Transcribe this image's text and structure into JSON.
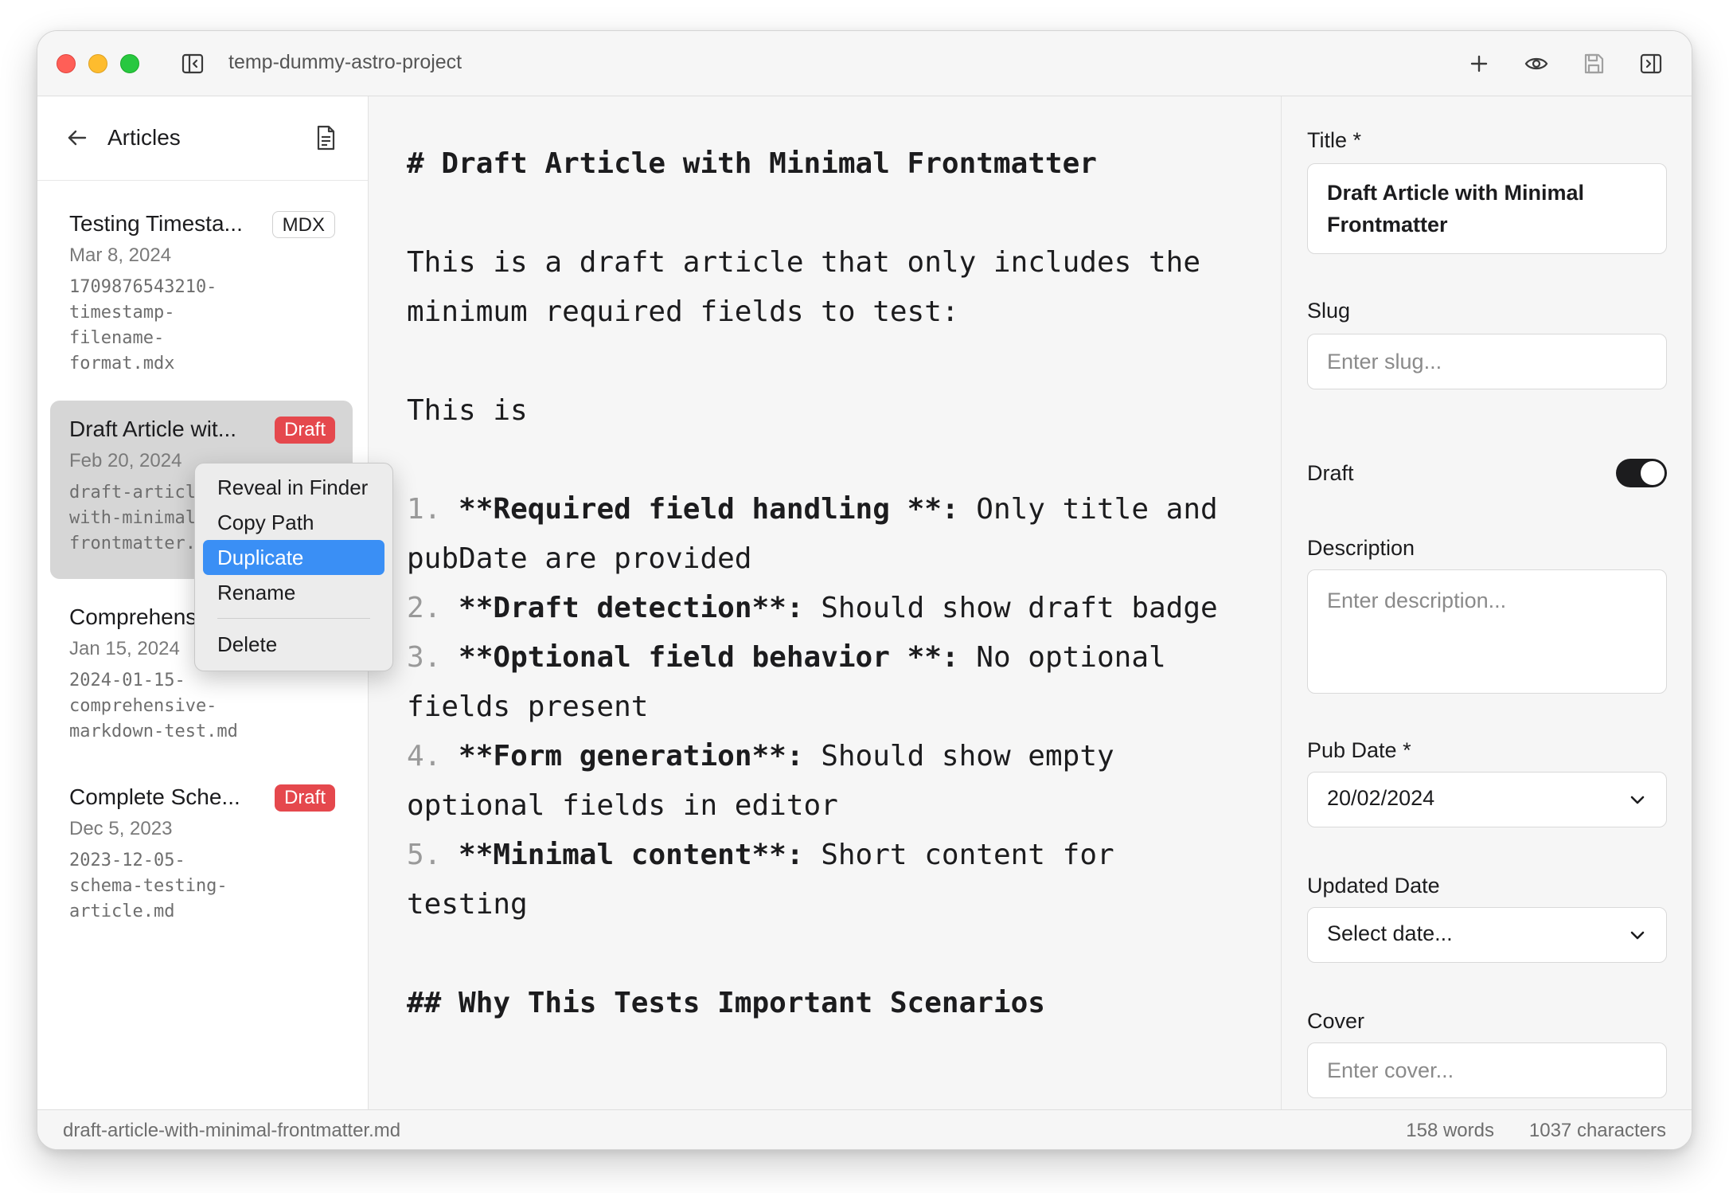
{
  "window": {
    "project_name": "temp-dummy-astro-project"
  },
  "toolbar": {
    "icons": [
      "sidebar-toggle-icon",
      "plus-icon",
      "eye-icon",
      "save-icon",
      "right-panel-toggle-icon"
    ]
  },
  "sidebar": {
    "title": "Articles",
    "articles": [
      {
        "title": "Testing Timesta...",
        "date": "Mar 8, 2024",
        "filename": "1709876543210-\ntimestamp-\nfilename-\nformat.mdx",
        "badge": "MDX",
        "selected": false
      },
      {
        "title": "Draft Article wit...",
        "date": "Feb 20, 2024",
        "filename": "draft-article-\nwith-minimal-\nfrontmatter.md",
        "badge": "Draft",
        "selected": true
      },
      {
        "title": "Comprehensive Ma...",
        "date": "Jan 15, 2024",
        "filename": "2024-01-15-\ncomprehensive-\nmarkdown-test.md",
        "badge": "",
        "selected": false
      },
      {
        "title": "Complete Sche...",
        "date": "Dec 5, 2023",
        "filename": "2023-12-05-\nschema-testing-\narticle.md",
        "badge": "Draft",
        "selected": false
      }
    ]
  },
  "context_menu": {
    "items": [
      "Reveal in Finder",
      "Copy Path",
      "Duplicate",
      "Rename",
      "Delete"
    ],
    "active_item": "Duplicate"
  },
  "editor": {
    "heading": "# Draft Article with Minimal Frontmatter",
    "para1_line1": "This is a draft article that only includes the",
    "para1_line2": "minimum required fields to test:",
    "para2": "This is",
    "list": [
      {
        "num": "1.",
        "bold": "**Required field handling **:",
        "rest": " Only title and",
        "cont": "pubDate are provided"
      },
      {
        "num": "2.",
        "bold": "**Draft detection**:",
        "rest": " Should show draft badge",
        "cont": ""
      },
      {
        "num": "3.",
        "bold": "**Optional field behavior **:",
        "rest": " No optional",
        "cont": "fields present"
      },
      {
        "num": "4.",
        "bold": "**Form generation**:",
        "rest": " Should show empty",
        "cont": "optional fields in editor"
      },
      {
        "num": "5.",
        "bold": "**Minimal content**:",
        "rest": " Short content for",
        "cont": "testing"
      }
    ],
    "subheading": "## Why This Tests Important Scenarios"
  },
  "panel": {
    "title_label": "Title *",
    "title_value": "Draft Article with Minimal Frontmatter",
    "slug_label": "Slug",
    "slug_placeholder": "Enter slug...",
    "draft_label": "Draft",
    "draft_on": true,
    "description_label": "Description",
    "description_placeholder": "Enter description...",
    "pubdate_label": "Pub Date *",
    "pubdate_value": "20/02/2024",
    "updated_label": "Updated Date",
    "updated_placeholder": "Select date...",
    "cover_label": "Cover",
    "cover_placeholder": "Enter cover..."
  },
  "status": {
    "filename": "draft-article-with-minimal-frontmatter.md",
    "words": "158 words",
    "characters": "1037 characters"
  },
  "colors": {
    "accent": "#3a8ff5",
    "draft_badge": "#e5484d",
    "close": "#ff5f57",
    "minimize": "#febc2e",
    "zoom": "#28c840"
  }
}
